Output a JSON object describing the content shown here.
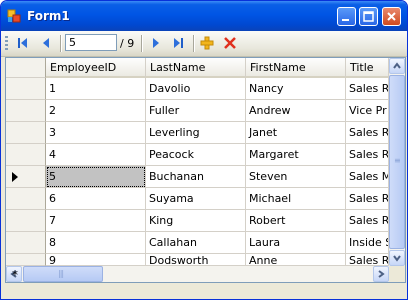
{
  "window": {
    "title": "Form1",
    "accent": "#0055e5"
  },
  "toolbar": {
    "move_first_icon": "move-first-icon",
    "move_previous_icon": "move-previous-icon",
    "position_value": "5",
    "count_text": "/ 9",
    "move_next_icon": "move-next-icon",
    "move_last_icon": "move-last-icon",
    "add_new_icon": "add-new-icon",
    "delete_icon": "delete-icon"
  },
  "grid": {
    "columns": [
      "EmployeeID",
      "LastName",
      "FirstName",
      "Title"
    ],
    "rows": [
      [
        "1",
        "Davolio",
        "Nancy",
        "Sales R"
      ],
      [
        "2",
        "Fuller",
        "Andrew",
        "Vice Pr"
      ],
      [
        "3",
        "Leverling",
        "Janet",
        "Sales R"
      ],
      [
        "4",
        "Peacock",
        "Margaret",
        "Sales R"
      ],
      [
        "5",
        "Buchanan",
        "Steven",
        "Sales M"
      ],
      [
        "6",
        "Suyama",
        "Michael",
        "Sales R"
      ],
      [
        "7",
        "King",
        "Robert",
        "Sales R"
      ],
      [
        "8",
        "Callahan",
        "Laura",
        "Inside S"
      ],
      [
        "9",
        "Dodsworth",
        "Anne",
        "Sales R"
      ]
    ],
    "current_row_index": 4,
    "selected_cell": "5",
    "new_row_marker": "*"
  }
}
